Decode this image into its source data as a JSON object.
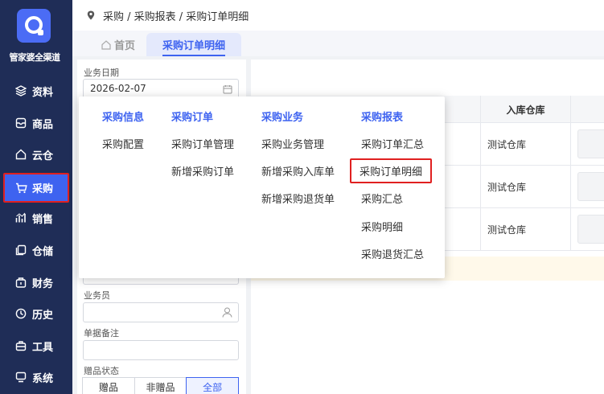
{
  "brand": {
    "name": "管家婆全渠道"
  },
  "sidebar": {
    "items": [
      {
        "label": "资料",
        "icon": "layers-icon"
      },
      {
        "label": "商品",
        "icon": "inbox-icon"
      },
      {
        "label": "云仓",
        "icon": "house-icon"
      },
      {
        "label": "采购",
        "icon": "cart-icon",
        "active": true
      },
      {
        "label": "销售",
        "icon": "chart-icon"
      },
      {
        "label": "仓储",
        "icon": "copy-icon"
      },
      {
        "label": "财务",
        "icon": "bag-icon"
      },
      {
        "label": "历史",
        "icon": "clock-icon"
      },
      {
        "label": "工具",
        "icon": "toolbox-icon"
      },
      {
        "label": "系统",
        "icon": "monitor-icon"
      }
    ]
  },
  "header": {
    "breadcrumb": "采购 / 采购报表 / 采购订单明细"
  },
  "tabs": {
    "home": "首页",
    "current": "采购订单明细"
  },
  "filters": {
    "date_label": "业务日期",
    "date_value": "2026-02-07",
    "staff_label": "业务员",
    "note_label": "单据备注",
    "gift_label": "赠品状态",
    "gift_options": [
      "赠品",
      "非赠品",
      "全部"
    ],
    "gift_selected": "全部"
  },
  "table": {
    "column_warehouse": "入库仓库",
    "rows": [
      {
        "warehouse": "测试仓库"
      },
      {
        "warehouse": "测试仓库"
      },
      {
        "warehouse": "测试仓库"
      }
    ]
  },
  "menu": {
    "columns": [
      {
        "title": "采购信息",
        "items": [
          "采购配置"
        ]
      },
      {
        "title": "采购订单",
        "items": [
          "采购订单管理",
          "新增采购订单"
        ]
      },
      {
        "title": "采购业务",
        "items": [
          "采购业务管理",
          "新增采购入库单",
          "新增采购退货单"
        ]
      },
      {
        "title": "采购报表",
        "items": [
          "采购订单汇总",
          "采购订单明细",
          "采购汇总",
          "采购明细",
          "采购退货汇总"
        ]
      }
    ],
    "highlighted": "采购订单明细"
  },
  "colors": {
    "sidebar": "#1f2d57",
    "accent": "#3e63f0",
    "highlight_border": "#e02020"
  }
}
